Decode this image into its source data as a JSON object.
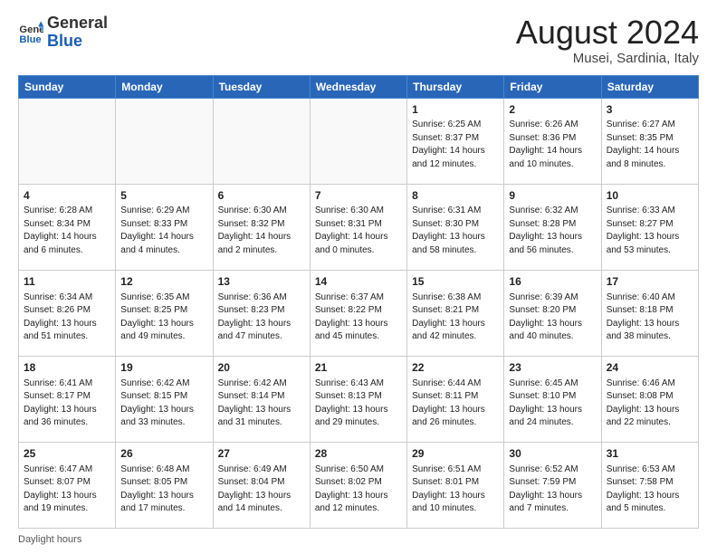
{
  "header": {
    "logo_line1": "General",
    "logo_line2": "Blue",
    "title": "August 2024",
    "subtitle": "Musei, Sardinia, Italy"
  },
  "days_of_week": [
    "Sunday",
    "Monday",
    "Tuesday",
    "Wednesday",
    "Thursday",
    "Friday",
    "Saturday"
  ],
  "weeks": [
    [
      {
        "day": "",
        "info": ""
      },
      {
        "day": "",
        "info": ""
      },
      {
        "day": "",
        "info": ""
      },
      {
        "day": "",
        "info": ""
      },
      {
        "day": "1",
        "info": "Sunrise: 6:25 AM\nSunset: 8:37 PM\nDaylight: 14 hours\nand 12 minutes."
      },
      {
        "day": "2",
        "info": "Sunrise: 6:26 AM\nSunset: 8:36 PM\nDaylight: 14 hours\nand 10 minutes."
      },
      {
        "day": "3",
        "info": "Sunrise: 6:27 AM\nSunset: 8:35 PM\nDaylight: 14 hours\nand 8 minutes."
      }
    ],
    [
      {
        "day": "4",
        "info": "Sunrise: 6:28 AM\nSunset: 8:34 PM\nDaylight: 14 hours\nand 6 minutes."
      },
      {
        "day": "5",
        "info": "Sunrise: 6:29 AM\nSunset: 8:33 PM\nDaylight: 14 hours\nand 4 minutes."
      },
      {
        "day": "6",
        "info": "Sunrise: 6:30 AM\nSunset: 8:32 PM\nDaylight: 14 hours\nand 2 minutes."
      },
      {
        "day": "7",
        "info": "Sunrise: 6:30 AM\nSunset: 8:31 PM\nDaylight: 14 hours\nand 0 minutes."
      },
      {
        "day": "8",
        "info": "Sunrise: 6:31 AM\nSunset: 8:30 PM\nDaylight: 13 hours\nand 58 minutes."
      },
      {
        "day": "9",
        "info": "Sunrise: 6:32 AM\nSunset: 8:28 PM\nDaylight: 13 hours\nand 56 minutes."
      },
      {
        "day": "10",
        "info": "Sunrise: 6:33 AM\nSunset: 8:27 PM\nDaylight: 13 hours\nand 53 minutes."
      }
    ],
    [
      {
        "day": "11",
        "info": "Sunrise: 6:34 AM\nSunset: 8:26 PM\nDaylight: 13 hours\nand 51 minutes."
      },
      {
        "day": "12",
        "info": "Sunrise: 6:35 AM\nSunset: 8:25 PM\nDaylight: 13 hours\nand 49 minutes."
      },
      {
        "day": "13",
        "info": "Sunrise: 6:36 AM\nSunset: 8:23 PM\nDaylight: 13 hours\nand 47 minutes."
      },
      {
        "day": "14",
        "info": "Sunrise: 6:37 AM\nSunset: 8:22 PM\nDaylight: 13 hours\nand 45 minutes."
      },
      {
        "day": "15",
        "info": "Sunrise: 6:38 AM\nSunset: 8:21 PM\nDaylight: 13 hours\nand 42 minutes."
      },
      {
        "day": "16",
        "info": "Sunrise: 6:39 AM\nSunset: 8:20 PM\nDaylight: 13 hours\nand 40 minutes."
      },
      {
        "day": "17",
        "info": "Sunrise: 6:40 AM\nSunset: 8:18 PM\nDaylight: 13 hours\nand 38 minutes."
      }
    ],
    [
      {
        "day": "18",
        "info": "Sunrise: 6:41 AM\nSunset: 8:17 PM\nDaylight: 13 hours\nand 36 minutes."
      },
      {
        "day": "19",
        "info": "Sunrise: 6:42 AM\nSunset: 8:15 PM\nDaylight: 13 hours\nand 33 minutes."
      },
      {
        "day": "20",
        "info": "Sunrise: 6:42 AM\nSunset: 8:14 PM\nDaylight: 13 hours\nand 31 minutes."
      },
      {
        "day": "21",
        "info": "Sunrise: 6:43 AM\nSunset: 8:13 PM\nDaylight: 13 hours\nand 29 minutes."
      },
      {
        "day": "22",
        "info": "Sunrise: 6:44 AM\nSunset: 8:11 PM\nDaylight: 13 hours\nand 26 minutes."
      },
      {
        "day": "23",
        "info": "Sunrise: 6:45 AM\nSunset: 8:10 PM\nDaylight: 13 hours\nand 24 minutes."
      },
      {
        "day": "24",
        "info": "Sunrise: 6:46 AM\nSunset: 8:08 PM\nDaylight: 13 hours\nand 22 minutes."
      }
    ],
    [
      {
        "day": "25",
        "info": "Sunrise: 6:47 AM\nSunset: 8:07 PM\nDaylight: 13 hours\nand 19 minutes."
      },
      {
        "day": "26",
        "info": "Sunrise: 6:48 AM\nSunset: 8:05 PM\nDaylight: 13 hours\nand 17 minutes."
      },
      {
        "day": "27",
        "info": "Sunrise: 6:49 AM\nSunset: 8:04 PM\nDaylight: 13 hours\nand 14 minutes."
      },
      {
        "day": "28",
        "info": "Sunrise: 6:50 AM\nSunset: 8:02 PM\nDaylight: 13 hours\nand 12 minutes."
      },
      {
        "day": "29",
        "info": "Sunrise: 6:51 AM\nSunset: 8:01 PM\nDaylight: 13 hours\nand 10 minutes."
      },
      {
        "day": "30",
        "info": "Sunrise: 6:52 AM\nSunset: 7:59 PM\nDaylight: 13 hours\nand 7 minutes."
      },
      {
        "day": "31",
        "info": "Sunrise: 6:53 AM\nSunset: 7:58 PM\nDaylight: 13 hours\nand 5 minutes."
      }
    ]
  ],
  "footer": {
    "note": "Daylight hours"
  }
}
